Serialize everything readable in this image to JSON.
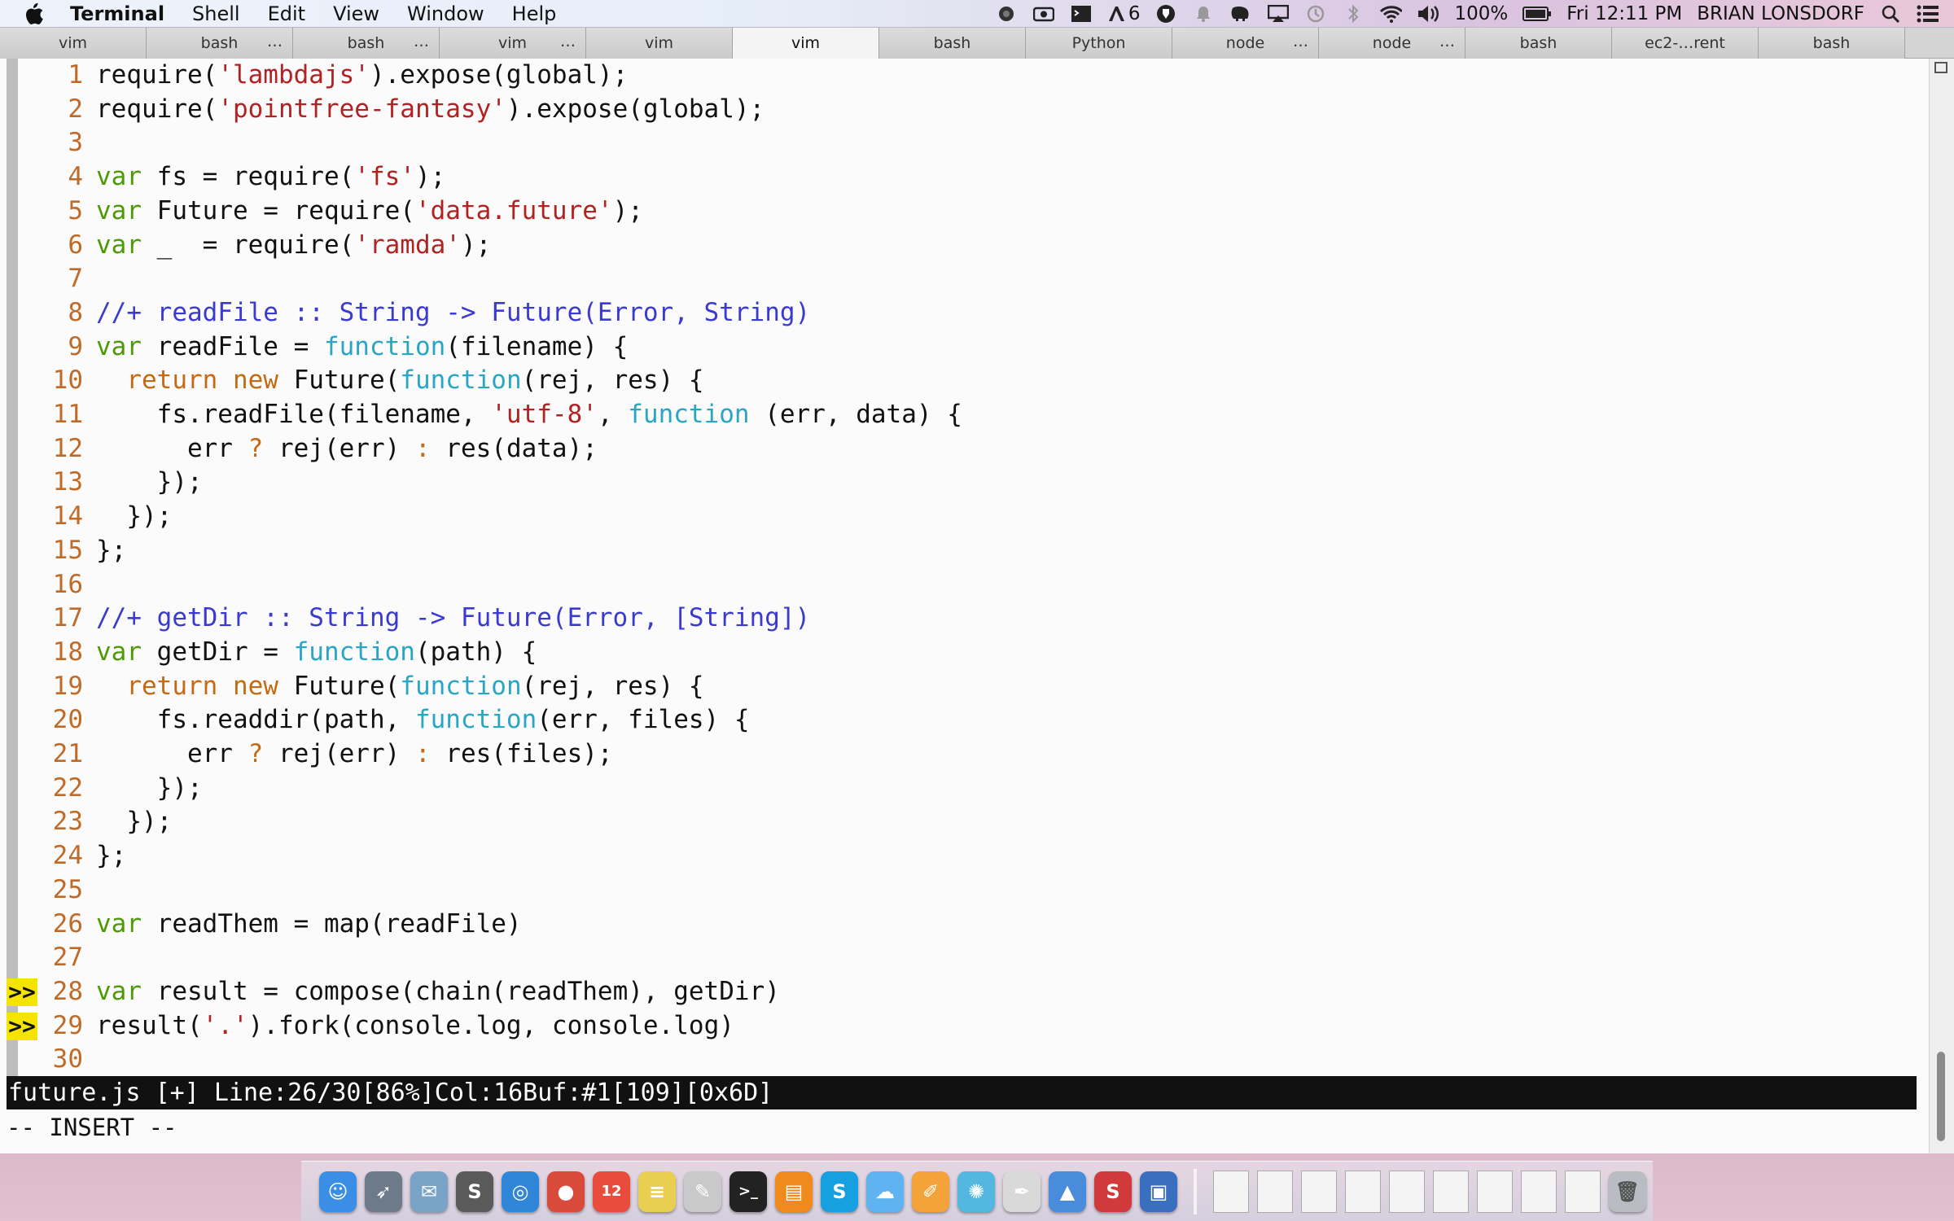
{
  "menubar": {
    "app_name": "Terminal",
    "menus": [
      "Shell",
      "Edit",
      "View",
      "Window",
      "Help"
    ],
    "status_icons": [
      "screen-record-icon",
      "camera-icon",
      "terminal-icon",
      "adobe-icon",
      "yelp-icon",
      "bell-icon",
      "elephant-icon",
      "airplay-icon",
      "time-machine-icon",
      "bluetooth-icon",
      "wifi-icon",
      "volume-icon"
    ],
    "adobe_count": "6",
    "battery": "100%",
    "clock": "Fri 12:11 PM",
    "user": "BRIAN LONSDORF"
  },
  "tabs": [
    {
      "label": "vim",
      "dots": "",
      "active": false
    },
    {
      "label": "bash",
      "dots": "…",
      "active": false
    },
    {
      "label": "bash",
      "dots": "…",
      "active": false
    },
    {
      "label": "vim",
      "dots": "…",
      "active": false
    },
    {
      "label": "vim",
      "dots": "",
      "active": false
    },
    {
      "label": "vim",
      "dots": "",
      "active": true
    },
    {
      "label": "bash",
      "dots": "",
      "active": false
    },
    {
      "label": "Python",
      "dots": "",
      "active": false
    },
    {
      "label": "node",
      "dots": "…",
      "active": false
    },
    {
      "label": "node",
      "dots": "…",
      "active": false
    },
    {
      "label": "bash",
      "dots": "",
      "active": false
    },
    {
      "label": "ec2-…rent",
      "dots": "",
      "active": false
    },
    {
      "label": "bash",
      "dots": "",
      "active": false
    }
  ],
  "editor": {
    "lines": [
      {
        "n": "1",
        "sign": "",
        "code": [
          [
            "p",
            "require("
          ],
          [
            "str",
            "'lambdajs'"
          ],
          [
            "p",
            ").expose(global);"
          ]
        ]
      },
      {
        "n": "2",
        "sign": "",
        "code": [
          [
            "p",
            "require("
          ],
          [
            "str",
            "'pointfree-fantasy'"
          ],
          [
            "p",
            ").expose(global);"
          ]
        ]
      },
      {
        "n": "3",
        "sign": "",
        "code": []
      },
      {
        "n": "4",
        "sign": "",
        "code": [
          [
            "kw",
            "var"
          ],
          [
            "p",
            " fs = require("
          ],
          [
            "str",
            "'fs'"
          ],
          [
            "p",
            ");"
          ]
        ]
      },
      {
        "n": "5",
        "sign": "",
        "code": [
          [
            "kw",
            "var"
          ],
          [
            "p",
            " Future = require("
          ],
          [
            "str",
            "'data.future'"
          ],
          [
            "p",
            ");"
          ]
        ]
      },
      {
        "n": "6",
        "sign": "",
        "code": [
          [
            "kw",
            "var"
          ],
          [
            "p",
            " _  = require("
          ],
          [
            "str",
            "'ramda'"
          ],
          [
            "p",
            ");"
          ]
        ]
      },
      {
        "n": "7",
        "sign": "",
        "code": []
      },
      {
        "n": "8",
        "sign": "",
        "code": [
          [
            "cm",
            "//+ readFile :: String -> Future(Error, String)"
          ]
        ]
      },
      {
        "n": "9",
        "sign": "",
        "code": [
          [
            "kw",
            "var"
          ],
          [
            "p",
            " readFile = "
          ],
          [
            "fn",
            "function"
          ],
          [
            "p",
            "(filename) {"
          ]
        ]
      },
      {
        "n": "10",
        "sign": "",
        "code": [
          [
            "p",
            "  "
          ],
          [
            "kw2",
            "return"
          ],
          [
            "p",
            " "
          ],
          [
            "kw2",
            "new"
          ],
          [
            "p",
            " Future("
          ],
          [
            "fn",
            "function"
          ],
          [
            "p",
            "(rej, res) {"
          ]
        ]
      },
      {
        "n": "11",
        "sign": "",
        "code": [
          [
            "p",
            "    fs.readFile(filename, "
          ],
          [
            "str",
            "'utf-8'"
          ],
          [
            "p",
            ", "
          ],
          [
            "fn",
            "function"
          ],
          [
            "p",
            " (err, data) {"
          ]
        ]
      },
      {
        "n": "12",
        "sign": "",
        "code": [
          [
            "p",
            "      err "
          ],
          [
            "kw2",
            "?"
          ],
          [
            "p",
            " rej(err) "
          ],
          [
            "kw2",
            ":"
          ],
          [
            "p",
            " res(data);"
          ]
        ]
      },
      {
        "n": "13",
        "sign": "",
        "code": [
          [
            "p",
            "    });"
          ]
        ]
      },
      {
        "n": "14",
        "sign": "",
        "code": [
          [
            "p",
            "  });"
          ]
        ]
      },
      {
        "n": "15",
        "sign": "",
        "code": [
          [
            "p",
            "};"
          ]
        ]
      },
      {
        "n": "16",
        "sign": "",
        "code": []
      },
      {
        "n": "17",
        "sign": "",
        "code": [
          [
            "cm",
            "//+ getDir :: String -> Future(Error, [String])"
          ]
        ]
      },
      {
        "n": "18",
        "sign": "",
        "code": [
          [
            "kw",
            "var"
          ],
          [
            "p",
            " getDir = "
          ],
          [
            "fn",
            "function"
          ],
          [
            "p",
            "(path) {"
          ]
        ]
      },
      {
        "n": "19",
        "sign": "",
        "code": [
          [
            "p",
            "  "
          ],
          [
            "kw2",
            "return"
          ],
          [
            "p",
            " "
          ],
          [
            "kw2",
            "new"
          ],
          [
            "p",
            " Future("
          ],
          [
            "fn",
            "function"
          ],
          [
            "p",
            "(rej, res) {"
          ]
        ]
      },
      {
        "n": "20",
        "sign": "",
        "code": [
          [
            "p",
            "    fs.readdir(path, "
          ],
          [
            "fn",
            "function"
          ],
          [
            "p",
            "(err, files) {"
          ]
        ]
      },
      {
        "n": "21",
        "sign": "",
        "code": [
          [
            "p",
            "      err "
          ],
          [
            "kw2",
            "?"
          ],
          [
            "p",
            " rej(err) "
          ],
          [
            "kw2",
            ":"
          ],
          [
            "p",
            " res(files);"
          ]
        ]
      },
      {
        "n": "22",
        "sign": "",
        "code": [
          [
            "p",
            "    });"
          ]
        ]
      },
      {
        "n": "23",
        "sign": "",
        "code": [
          [
            "p",
            "  });"
          ]
        ]
      },
      {
        "n": "24",
        "sign": "",
        "code": [
          [
            "p",
            "};"
          ]
        ]
      },
      {
        "n": "25",
        "sign": "",
        "code": []
      },
      {
        "n": "26",
        "sign": "",
        "code": [
          [
            "kw",
            "var"
          ],
          [
            "p",
            " readThem = map(readFile)"
          ]
        ]
      },
      {
        "n": "27",
        "sign": "",
        "code": []
      },
      {
        "n": "28",
        "sign": ">>",
        "code": [
          [
            "kw",
            "var"
          ],
          [
            "p",
            " result = compose(chain(readThem), getDir)"
          ]
        ]
      },
      {
        "n": "29",
        "sign": ">>",
        "code": [
          [
            "p",
            "result("
          ],
          [
            "str",
            "'.'"
          ],
          [
            "p",
            ").fork(console.log, console.log)"
          ]
        ]
      },
      {
        "n": "30",
        "sign": "",
        "code": []
      }
    ],
    "statusline": "future.js [+] Line:26/30[86%]Col:16Buf:#1[109][0x6D]",
    "mode": "-- INSERT --"
  },
  "dock": {
    "icons": [
      {
        "name": "finder-icon",
        "glyph": "☺",
        "color": "#3a8ee6"
      },
      {
        "name": "launchpad-icon",
        "glyph": "➶",
        "color": "#6d7a8a"
      },
      {
        "name": "preview-icon",
        "glyph": "✉",
        "color": "#7aa3c8"
      },
      {
        "name": "sublime-icon",
        "glyph": "S",
        "color": "#5a5a5a"
      },
      {
        "name": "safari-icon",
        "glyph": "◎",
        "color": "#2f86d8"
      },
      {
        "name": "chrome-icon",
        "glyph": "●",
        "color": "#d84b3a"
      },
      {
        "name": "calendar-icon",
        "glyph": "12",
        "color": "#e84c3d"
      },
      {
        "name": "notes-icon",
        "glyph": "≡",
        "color": "#e9cf51"
      },
      {
        "name": "textedit-icon",
        "glyph": "✎",
        "color": "#c9c9c9"
      },
      {
        "name": "terminal-icon",
        "glyph": ">_",
        "color": "#222222"
      },
      {
        "name": "ibooks-icon",
        "glyph": "▤",
        "color": "#f08a1c"
      },
      {
        "name": "skype-icon",
        "glyph": "S",
        "color": "#16a0e0"
      },
      {
        "name": "messages-icon",
        "glyph": "☁",
        "color": "#5fb3f0"
      },
      {
        "name": "pages-icon",
        "glyph": "✐",
        "color": "#f3a33a"
      },
      {
        "name": "sketchbook-icon",
        "glyph": "✺",
        "color": "#54b7e0"
      },
      {
        "name": "script-editor-icon",
        "glyph": "✒",
        "color": "#d9d9d9"
      },
      {
        "name": "keynote-icon",
        "glyph": "▲",
        "color": "#4a8cdc"
      },
      {
        "name": "s-app-icon",
        "glyph": "S",
        "color": "#d03a3a"
      },
      {
        "name": "screenflow-icon",
        "glyph": "▣",
        "color": "#3a6fc0"
      }
    ],
    "documents": 9
  }
}
